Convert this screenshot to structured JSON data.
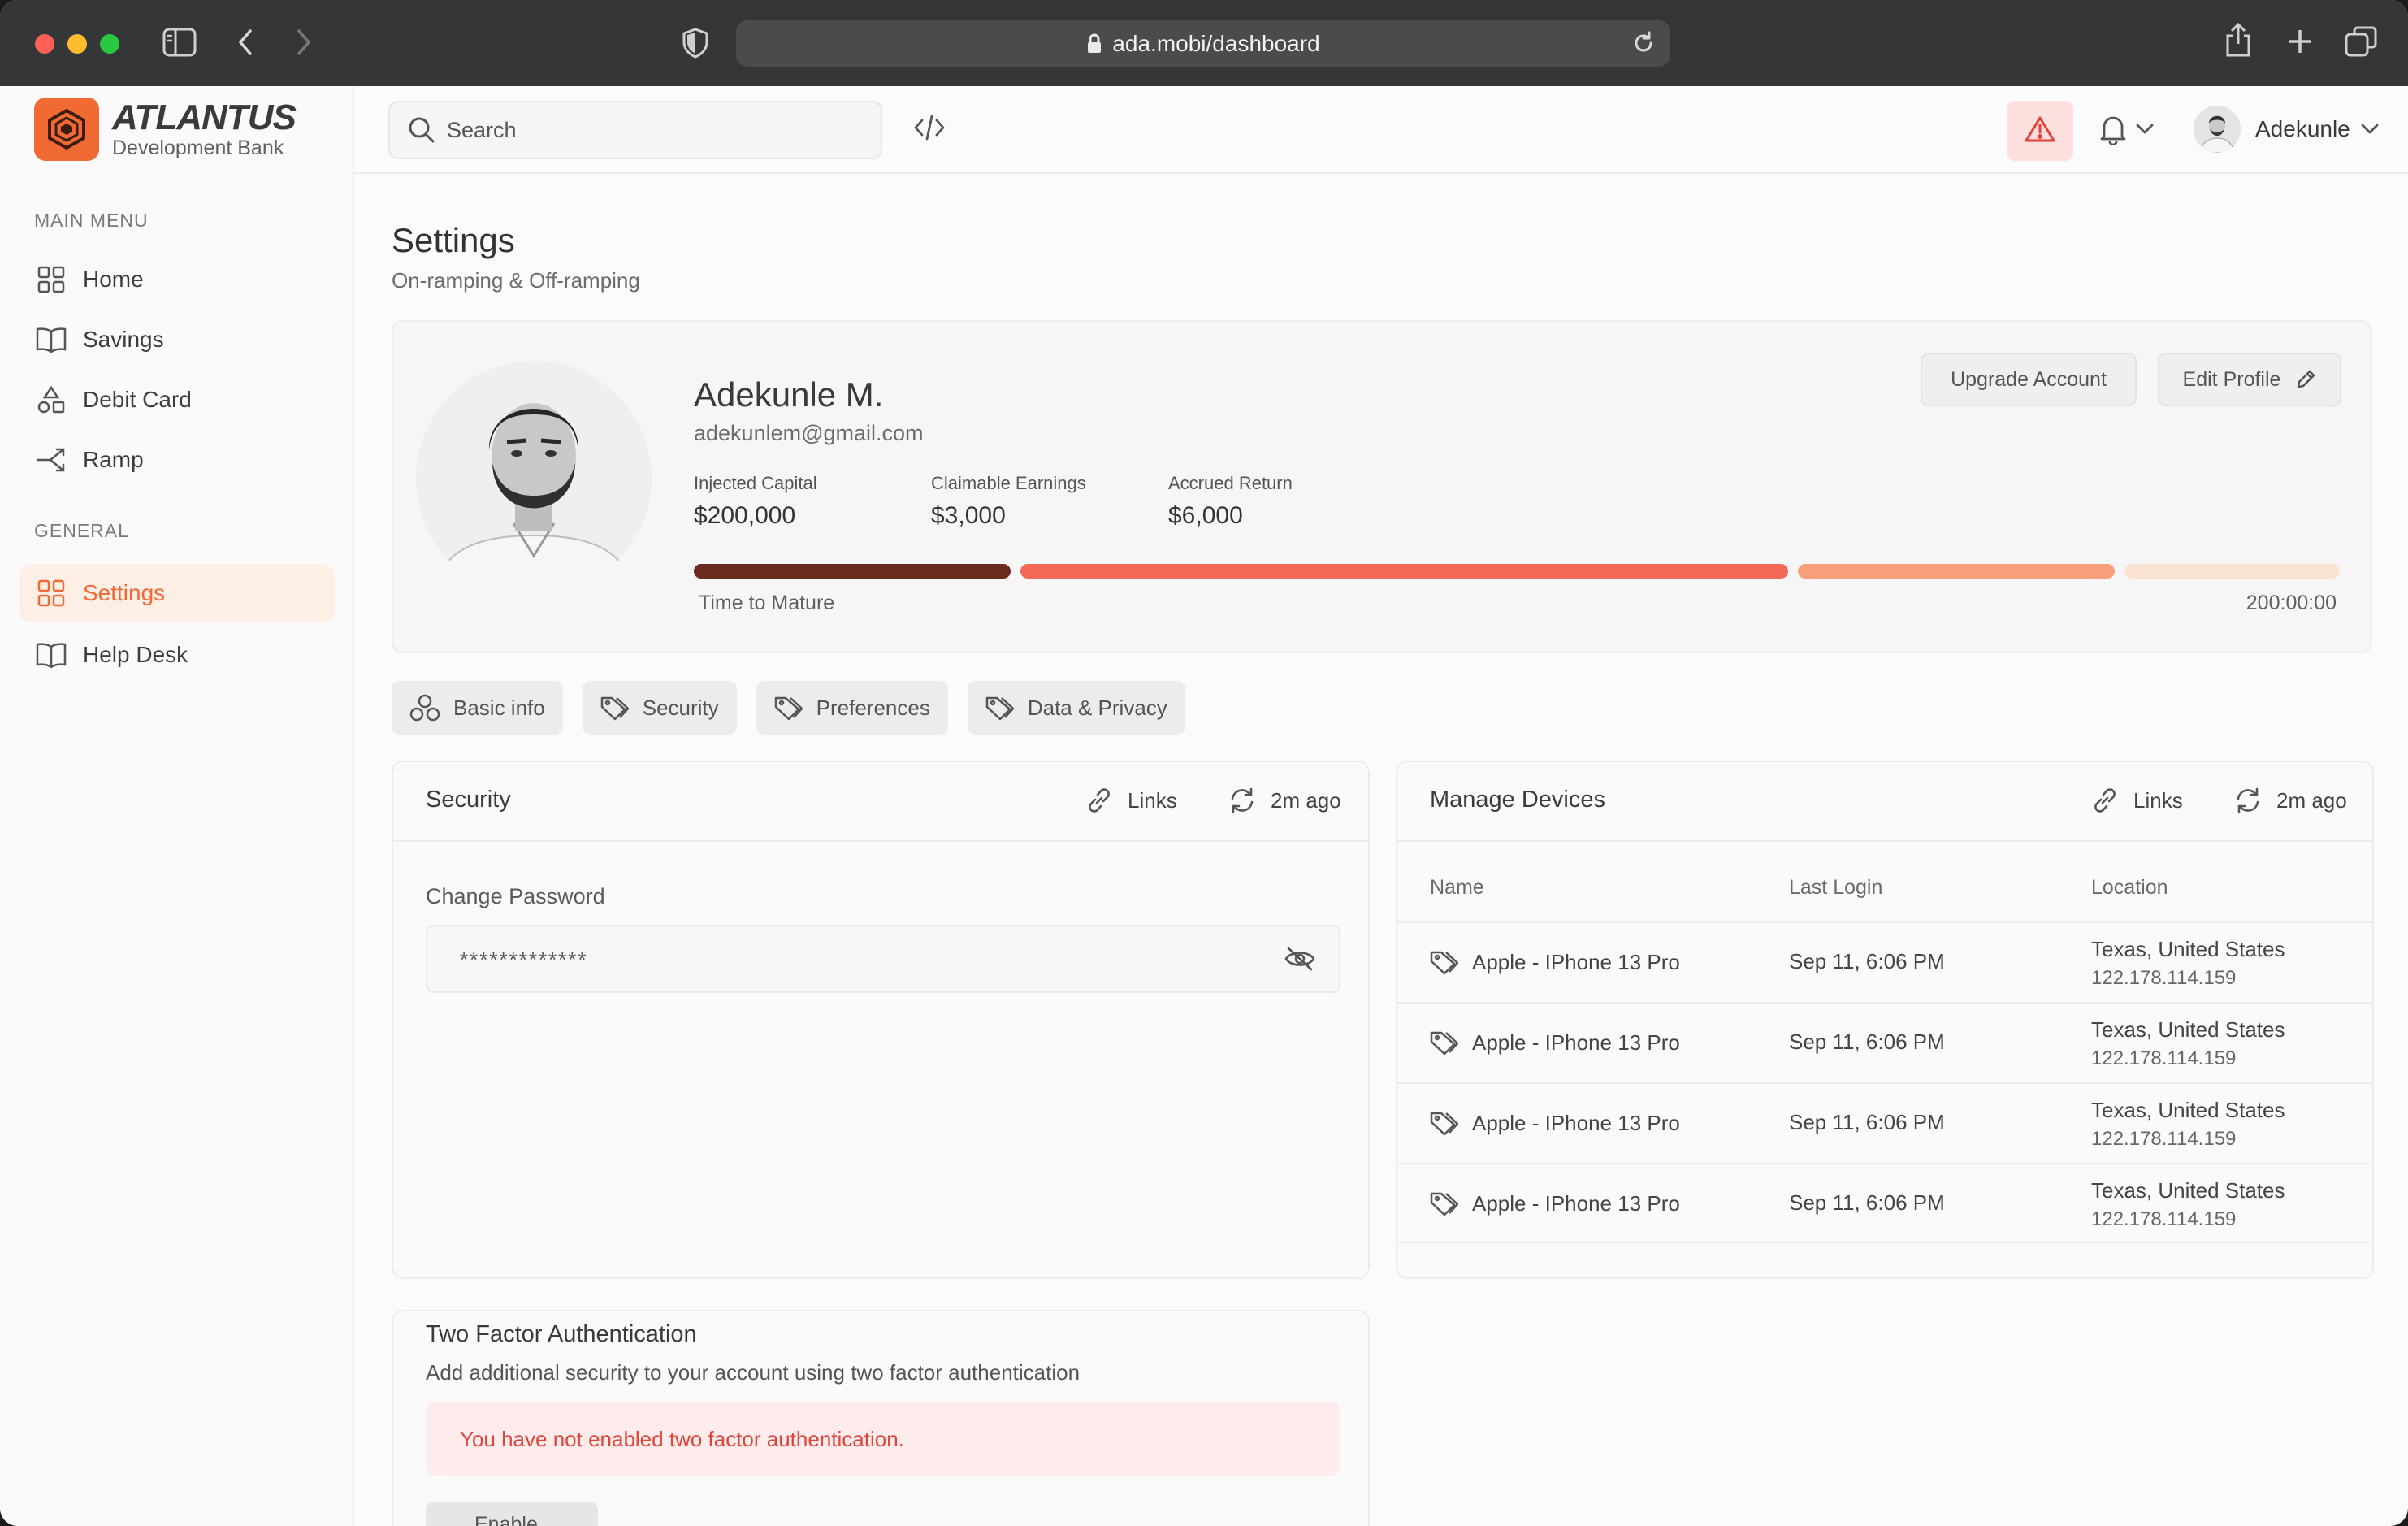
{
  "browser": {
    "url": "ada.mobi/dashboard"
  },
  "brand": {
    "name": "ATLANTUS",
    "subtitle": "Development Bank",
    "color": "#f26a33"
  },
  "sidebar": {
    "main_menu_label": "MAIN MENU",
    "general_label": "GENERAL",
    "main_items": [
      {
        "label": "Home",
        "icon": "grid-icon"
      },
      {
        "label": "Savings",
        "icon": "book-icon"
      },
      {
        "label": "Debit Card",
        "icon": "shapes-icon"
      },
      {
        "label": "Ramp",
        "icon": "ramp-icon"
      }
    ],
    "general_items": [
      {
        "label": "Settings",
        "icon": "grid-icon",
        "active": true
      },
      {
        "label": "Help Desk",
        "icon": "book-icon"
      }
    ]
  },
  "topbar": {
    "search_placeholder": "Search",
    "user_name": "Adekunle"
  },
  "page": {
    "title": "Settings",
    "subtitle": "On-ramping & Off-ramping"
  },
  "profile": {
    "name": "Adekunle M.",
    "email": "adekunlem@gmail.com",
    "upgrade_label": "Upgrade Account",
    "edit_label": "Edit Profile",
    "stats": [
      {
        "label": "Injected Capital",
        "value": "$200,000"
      },
      {
        "label": "Claimable Earnings",
        "value": "$3,000"
      },
      {
        "label": "Accrued Return",
        "value": "$6,000"
      }
    ],
    "progress": {
      "label": "Time to Mature",
      "value": "200:00:00",
      "segments": [
        {
          "fraction": 0.196,
          "color": "#6b2a1f"
        },
        {
          "fraction": 0.475,
          "color": "#f26a55"
        },
        {
          "fraction": 0.196,
          "color": "#f7a07a"
        },
        {
          "fraction": 0.133,
          "color": "#fbe3d3"
        }
      ]
    }
  },
  "tabs": [
    {
      "label": "Basic info",
      "icon": "users-icon"
    },
    {
      "label": "Security",
      "icon": "tag-icon"
    },
    {
      "label": "Preferences",
      "icon": "tag-icon"
    },
    {
      "label": "Data & Privacy",
      "icon": "tag-icon"
    }
  ],
  "security_panel": {
    "title": "Security",
    "links_label": "Links",
    "updated_label": "2m ago",
    "field_label": "Change Password",
    "password_value": "*************"
  },
  "devices_panel": {
    "title": "Manage Devices",
    "links_label": "Links",
    "updated_label": "2m ago",
    "columns": [
      "Name",
      "Last Login",
      "Location"
    ],
    "rows": [
      {
        "name": "Apple - IPhone 13 Pro",
        "last_login": "Sep 11, 6:06 PM",
        "location": "Texas, United States",
        "ip": "122.178.114.159"
      },
      {
        "name": "Apple - IPhone 13 Pro",
        "last_login": "Sep 11, 6:06 PM",
        "location": "Texas, United States",
        "ip": "122.178.114.159"
      },
      {
        "name": "Apple - IPhone 13 Pro",
        "last_login": "Sep 11, 6:06 PM",
        "location": "Texas, United States",
        "ip": "122.178.114.159"
      },
      {
        "name": "Apple - IPhone 13 Pro",
        "last_login": "Sep 11, 6:06 PM",
        "location": "Texas, United States",
        "ip": "122.178.114.159"
      }
    ]
  },
  "two_factor": {
    "title": "Two Factor Authentication",
    "description": "Add additional security to your account using two factor authentication",
    "alert": "You have not enabled two factor authentication.",
    "button_label": "Enable"
  }
}
